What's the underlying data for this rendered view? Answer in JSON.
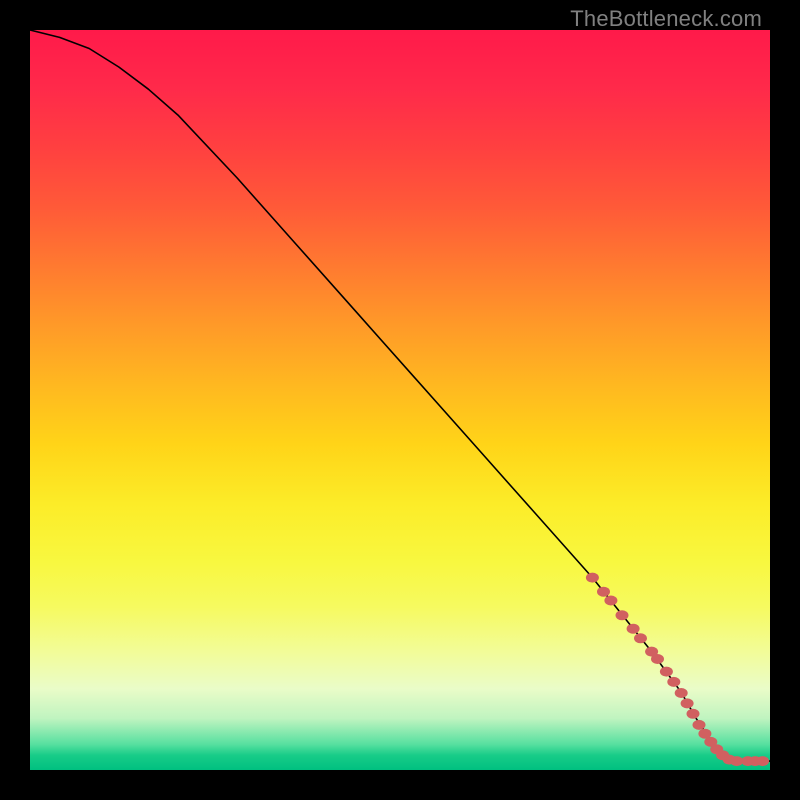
{
  "watermark": "TheBottleneck.com",
  "chart_data": {
    "type": "line",
    "title": "",
    "xlabel": "",
    "ylabel": "",
    "xlim": [
      0,
      100
    ],
    "ylim": [
      0,
      100
    ],
    "series": [
      {
        "name": "curve",
        "x": [
          0,
          4,
          8,
          12,
          16,
          20,
          28,
          36,
          44,
          52,
          60,
          68,
          76,
          84,
          88,
          90,
          92,
          94,
          96,
          98,
          100
        ],
        "y": [
          100,
          99,
          97.5,
          95,
          92,
          88.5,
          80,
          71,
          62,
          53,
          44,
          35,
          26,
          16,
          10.5,
          7,
          4,
          2,
          1.2,
          1.2,
          1.2
        ]
      }
    ],
    "markers": {
      "name": "highlighted-points",
      "points": [
        {
          "x": 76.0,
          "y": 26.0
        },
        {
          "x": 77.5,
          "y": 24.1
        },
        {
          "x": 78.5,
          "y": 22.9
        },
        {
          "x": 80.0,
          "y": 20.9
        },
        {
          "x": 81.5,
          "y": 19.1
        },
        {
          "x": 82.5,
          "y": 17.8
        },
        {
          "x": 84.0,
          "y": 16.0
        },
        {
          "x": 84.8,
          "y": 15.0
        },
        {
          "x": 86.0,
          "y": 13.3
        },
        {
          "x": 87.0,
          "y": 11.9
        },
        {
          "x": 88.0,
          "y": 10.4
        },
        {
          "x": 88.8,
          "y": 9.0
        },
        {
          "x": 89.6,
          "y": 7.6
        },
        {
          "x": 90.4,
          "y": 6.1
        },
        {
          "x": 91.2,
          "y": 4.9
        },
        {
          "x": 92.0,
          "y": 3.8
        },
        {
          "x": 92.8,
          "y": 2.8
        },
        {
          "x": 93.6,
          "y": 2.0
        },
        {
          "x": 94.5,
          "y": 1.4
        },
        {
          "x": 95.5,
          "y": 1.2
        },
        {
          "x": 97.0,
          "y": 1.2
        },
        {
          "x": 98.0,
          "y": 1.2
        },
        {
          "x": 99.0,
          "y": 1.2
        }
      ]
    }
  }
}
